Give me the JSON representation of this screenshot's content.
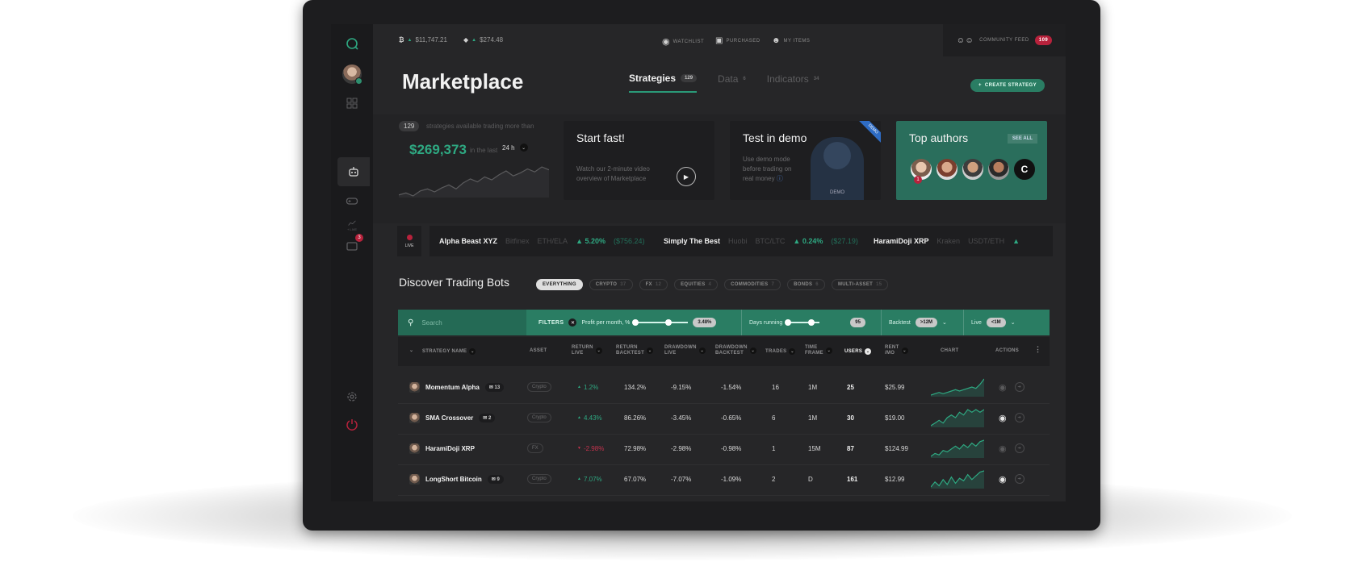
{
  "topbar": {
    "btc_icon": "bitcoin-icon",
    "btc_price": "$11,747.21",
    "eth_icon": "ethereum-icon",
    "eth_price": "$274.48",
    "nav": [
      {
        "label": "WATCHLIST",
        "icon": "eye-icon"
      },
      {
        "label": "PURCHASED",
        "icon": "briefcase-icon"
      },
      {
        "label": "MY ITEMS",
        "icon": "user-icon"
      }
    ],
    "community_label": "COMMUNITY FEED",
    "community_count": "109"
  },
  "sidebar": {
    "messages_badge": "3",
    "chart_label": "+ LIVE"
  },
  "page": {
    "title": "Marketplace",
    "tabs": [
      {
        "label": "Strategies",
        "count": "129"
      },
      {
        "label": "Data",
        "count": "6"
      },
      {
        "label": "Indicators",
        "count": "34"
      }
    ],
    "create_label": "CREATE STRATEGY"
  },
  "stats": {
    "count": "129",
    "desc": "strategies available trading more than",
    "amount": "$269,373",
    "in_the_last": "in the last",
    "period": "24 h",
    "sparkline": [
      18,
      20,
      17,
      22,
      24,
      21,
      25,
      28,
      24,
      30,
      34,
      31,
      36,
      33,
      38,
      42,
      37,
      40,
      44,
      41,
      46,
      43
    ]
  },
  "cards": {
    "start": {
      "title": "Start fast!",
      "sub1": "Watch our 2-minute video",
      "sub2": "overview of Marketplace"
    },
    "demo": {
      "title": "Test in demo",
      "sub1": "Use demo mode",
      "sub2": "before trading on",
      "sub3": "real money",
      "ribbon": "DEMO",
      "robot_label": "DEMO"
    },
    "top": {
      "title": "Top authors",
      "see_all": "SEE ALL",
      "badge": "1"
    }
  },
  "ticker": {
    "live_label": "LIVE",
    "items": [
      {
        "name": "Alpha Beast XYZ",
        "exchange": "Bitfinex",
        "pair": "ETH/ELA",
        "change": "5.20%",
        "value": "($756.24)"
      },
      {
        "name": "Simply The Best",
        "exchange": "Huobi",
        "pair": "BTC/LTC",
        "change": "0.24%",
        "value": "($27.19)"
      },
      {
        "name": "HaramiDoji XRP",
        "exchange": "Kraken",
        "pair": "USDT/ETH",
        "change": "",
        "value": ""
      }
    ]
  },
  "discover": {
    "title": "Discover Trading Bots",
    "chips": [
      {
        "label": "EVERYTHING",
        "count": ""
      },
      {
        "label": "CRYPTO",
        "count": "37"
      },
      {
        "label": "FX",
        "count": "12"
      },
      {
        "label": "EQUITIES",
        "count": "4"
      },
      {
        "label": "COMMODITIES",
        "count": "7"
      },
      {
        "label": "BONDS",
        "count": "6"
      },
      {
        "label": "MULTI-ASSET",
        "count": "15"
      }
    ]
  },
  "filters": {
    "search_placeholder": "Search",
    "filters_label": "FILTERS",
    "profit_label": "Profit per month, %",
    "profit_value": "3.48%",
    "days_label": "Days running",
    "days_value": "95",
    "backtest_label": "Backtest",
    "backtest_value": ">12M",
    "live_label": "Live",
    "live_value": "<1M"
  },
  "table": {
    "headers": {
      "name": "STRATEGY NAME",
      "asset": "ASSET",
      "return_live_1": "RETURN",
      "return_live_2": "LIVE",
      "return_bt_1": "RETURN",
      "return_bt_2": "BACKTEST",
      "dd_live_1": "DRAWDOWN",
      "dd_live_2": "LIVE",
      "dd_bt_1": "DRAWDOWN",
      "dd_bt_2": "BACKTEST",
      "trades": "TRADES",
      "tf_1": "TIME",
      "tf_2": "FRAME",
      "users": "USERS",
      "rent_1": "RENT",
      "rent_2": "/MO",
      "chart": "CHART",
      "actions": "ACTIONS"
    },
    "rows": [
      {
        "name": "Momentum Alpha",
        "comments": "13",
        "asset": "Crypto",
        "return_live": "1.2%",
        "return_dir": "up",
        "return_bt": "134.2%",
        "dd_live": "-9.15%",
        "dd_bt": "-1.54%",
        "trades": "16",
        "timeframe": "1M",
        "users": "25",
        "rent": "$25.99",
        "watched": false,
        "spark": [
          4,
          5,
          6,
          5,
          6,
          7,
          8,
          7,
          8,
          9,
          10,
          9,
          12,
          16
        ]
      },
      {
        "name": "SMA Crossover",
        "comments": "2",
        "asset": "Crypto",
        "return_live": "4.43%",
        "return_dir": "up",
        "return_bt": "86.26%",
        "dd_live": "-3.45%",
        "dd_bt": "-0.65%",
        "trades": "6",
        "timeframe": "1M",
        "users": "30",
        "rent": "$19.00",
        "watched": true,
        "spark": [
          5,
          6,
          7,
          6,
          8,
          9,
          8,
          10,
          9,
          11,
          10,
          11,
          10,
          11
        ]
      },
      {
        "name": "HaramiDoji XRP",
        "comments": "",
        "asset": "FX",
        "return_live": "-2.98%",
        "return_dir": "down",
        "return_bt": "72.98%",
        "dd_live": "-2.98%",
        "dd_bt": "-0.98%",
        "trades": "1",
        "timeframe": "15M",
        "users": "87",
        "rent": "$124.99",
        "watched": false,
        "spark": [
          4,
          6,
          5,
          8,
          7,
          9,
          11,
          9,
          12,
          10,
          13,
          11,
          14,
          15
        ]
      },
      {
        "name": "LongShort Bitcoin",
        "comments": "9",
        "asset": "Crypto",
        "return_live": "7.07%",
        "return_dir": "up",
        "return_bt": "67.07%",
        "dd_live": "-7.07%",
        "dd_bt": "-1.09%",
        "trades": "2",
        "timeframe": "D",
        "users": "161",
        "rent": "$12.99",
        "watched": true,
        "spark": [
          3,
          7,
          4,
          9,
          5,
          11,
          6,
          10,
          8,
          13,
          9,
          12,
          15,
          16
        ]
      }
    ]
  },
  "colors": {
    "accent": "#2a7d63",
    "positive": "#2ea982",
    "negative": "#c5334e",
    "alert": "#b8223c"
  }
}
